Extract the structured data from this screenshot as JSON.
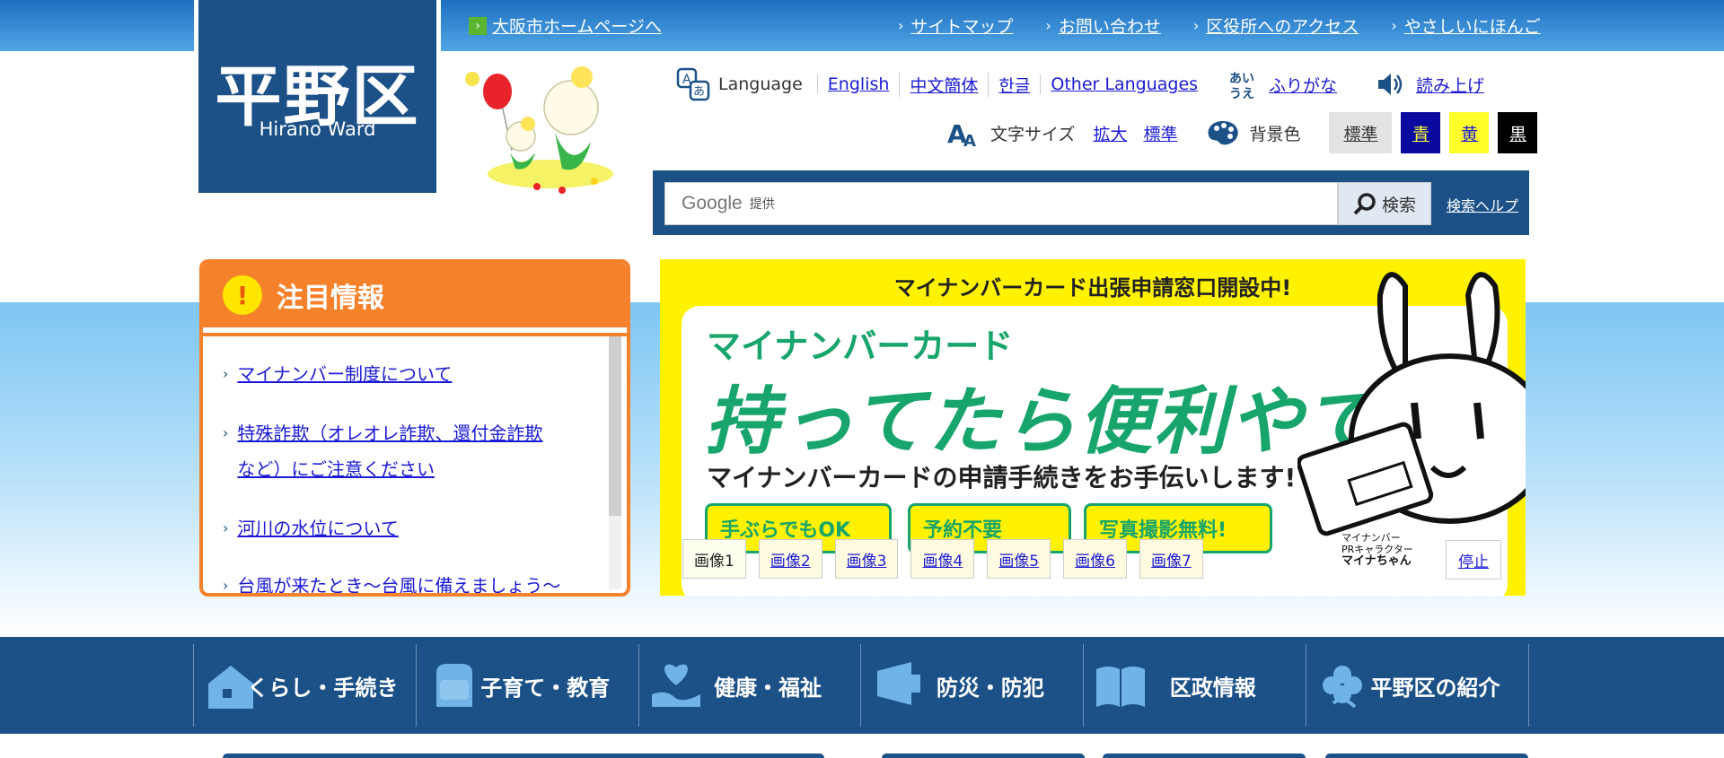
{
  "header": {
    "logo_jp": "平野区",
    "logo_en": "Hirano Ward",
    "osaka_link": "大阪市ホームページへ",
    "top_links": [
      "サイトマップ",
      "お問い合わせ",
      "区役所へのアクセス",
      "やさしいにほんご"
    ]
  },
  "language": {
    "label": "Language",
    "links": [
      "English",
      "中文簡体",
      "한글",
      "Other Languages"
    ],
    "kana_icon_text": "あい うえ",
    "furigana": "ふりがな",
    "read_aloud": "読み上げ"
  },
  "text_size": {
    "label": "文字サイズ",
    "enlarge": "拡大",
    "standard": "標準"
  },
  "bg_color": {
    "label": "背景色",
    "options": [
      "標準",
      "青",
      "黄",
      "黒"
    ],
    "colors": {
      "standard": "#e3e3e3",
      "blue": "#0a0aa0",
      "yellow": "#ffff2a",
      "black": "#000000"
    }
  },
  "search": {
    "google": "Google",
    "provided": "提供",
    "button": "検索",
    "help": "検索ヘルプ"
  },
  "news": {
    "title": "注目情報",
    "items": [
      [
        "マイナンバー制度について"
      ],
      [
        "特殊詐欺（オレオレ詐欺、還付金詐欺",
        "など）にご注意ください"
      ],
      [
        "河川の水位について"
      ],
      [
        "台風が来たとき～台風に備えましょう～"
      ]
    ]
  },
  "banner": {
    "top_text": "マイナンバーカード出張申請窓口開設中!",
    "line1": "マイナンバーカード",
    "line2": "持ってたら便利やで!",
    "line3": "マイナンバーカードの申請手続きをお手伝いします!",
    "pills": [
      "手ぶらでもOK",
      "予約不要",
      "写真撮影無料!"
    ],
    "character": [
      "マイナンバー",
      "PRキャラクター",
      "マイナちゃん"
    ],
    "slides": [
      "画像1",
      "画像2",
      "画像3",
      "画像4",
      "画像5",
      "画像6",
      "画像7"
    ],
    "stop": "停止",
    "accent": "#17a56b"
  },
  "nav": {
    "items": [
      "くらし・手続き",
      "子育て・教育",
      "健康・福祉",
      "防災・防犯",
      "区政情報",
      "平野区の紹介"
    ],
    "icons": [
      "house-icon",
      "school-bag-icon",
      "heart-hand-icon",
      "megaphone-icon",
      "book-icon",
      "flower-icon"
    ]
  }
}
